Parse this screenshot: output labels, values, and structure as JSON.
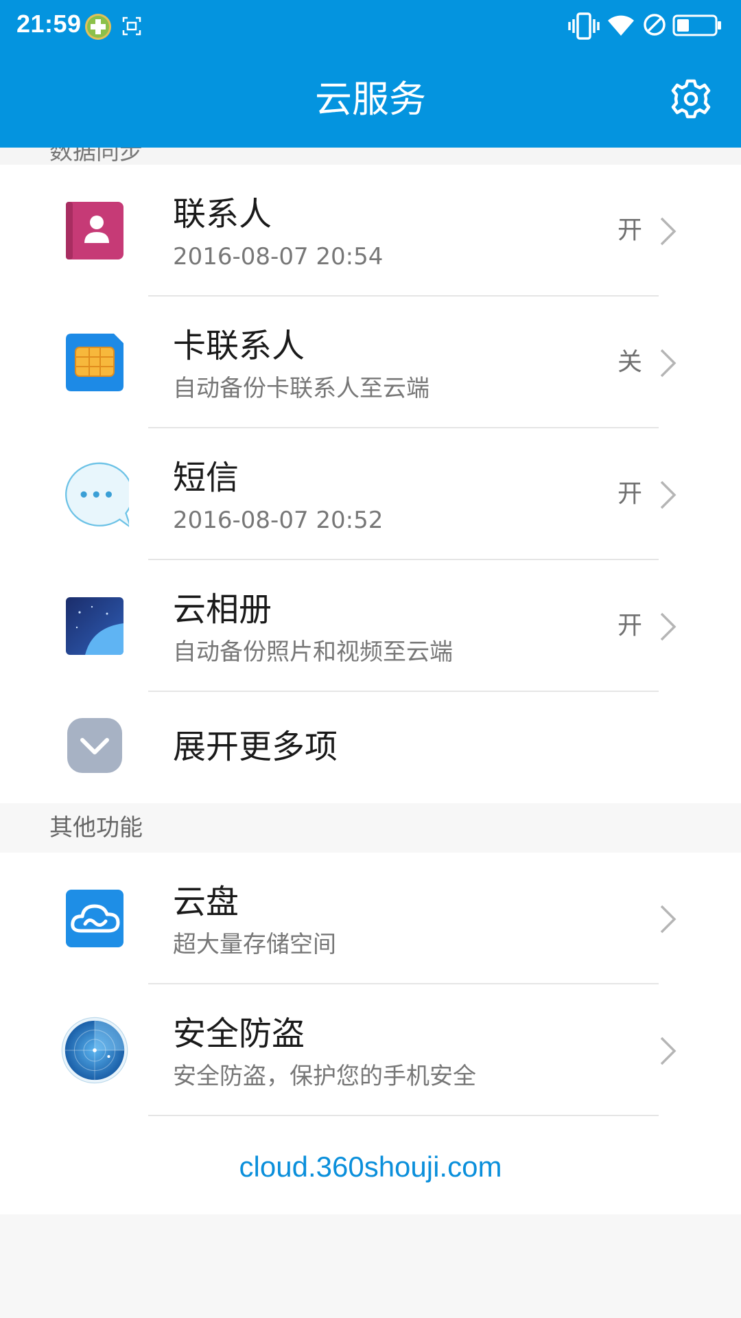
{
  "status_bar": {
    "time": "21:59"
  },
  "header": {
    "title": "云服务",
    "bg_color": "#0494df"
  },
  "section_top": {
    "label": "数据同步"
  },
  "sync_items": [
    {
      "icon": "contacts-icon",
      "name": "联系人",
      "sub": "2016-08-07 20:54",
      "state": "开"
    },
    {
      "icon": "sim-card-icon",
      "name": "卡联系人",
      "sub": "自动备份卡联系人至云端",
      "state": "关"
    },
    {
      "icon": "sms-icon",
      "name": "短信",
      "sub": "2016-08-07 20:52",
      "state": "开"
    },
    {
      "icon": "cloud-album-icon",
      "name": "云相册",
      "sub": "自动备份照片和视频至云端",
      "state": "开"
    }
  ],
  "expand_more": {
    "label": "展开更多项"
  },
  "section_other": {
    "label": "其他功能"
  },
  "other_items": [
    {
      "icon": "cloud-disk-icon",
      "name": "云盘",
      "sub": "超大量存储空间"
    },
    {
      "icon": "anti-theft-radar-icon",
      "name": "安全防盗",
      "sub": "安全防盗，保护您的手机安全"
    }
  ],
  "footer_link": "cloud.360shouji.com"
}
